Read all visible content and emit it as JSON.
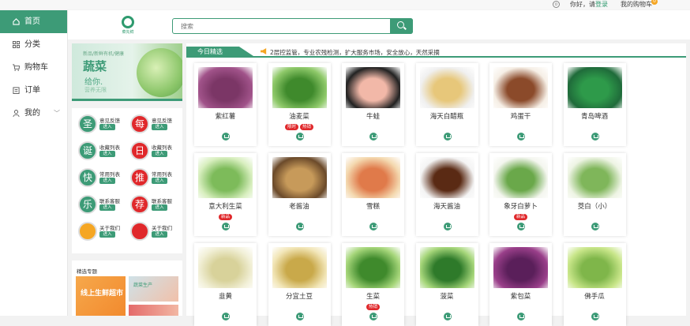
{
  "topbar": {
    "hello": "你好，请",
    "login": "登录",
    "cart_link": "我的购物车",
    "cart_count": "0"
  },
  "sidebar": {
    "items": [
      {
        "label": "首页",
        "icon": "home-icon"
      },
      {
        "label": "分类",
        "icon": "grid-icon"
      },
      {
        "label": "购物车",
        "icon": "cart-icon"
      },
      {
        "label": "订单",
        "icon": "clipboard-icon"
      },
      {
        "label": "我的",
        "icon": "user-icon"
      }
    ]
  },
  "header": {
    "logo_text": "菜先鲜",
    "search_placeholder": "搜索"
  },
  "banner": {
    "sub": "新品/新鲜有机/健康",
    "title": "蔬菜",
    "line2": "给你.",
    "line3": "营养无限"
  },
  "grid": {
    "items": [
      {
        "char": "圣",
        "label": "意见反馈",
        "btn": "进入",
        "color": "#3d9b77"
      },
      {
        "char": "每",
        "label": "意见反馈",
        "btn": "进入",
        "color": "#e0282b"
      },
      {
        "char": "诞",
        "label": "收藏列表",
        "btn": "进入",
        "color": "#3d9b77"
      },
      {
        "char": "日",
        "label": "收藏列表",
        "btn": "进入",
        "color": "#e0282b"
      },
      {
        "char": "快",
        "label": "常用列表",
        "btn": "进入",
        "color": "#3d9b77"
      },
      {
        "char": "推",
        "label": "常用列表",
        "btn": "进入",
        "color": "#e0282b"
      },
      {
        "char": "乐",
        "label": "联系客服",
        "btn": "进入",
        "color": "#3d9b77"
      },
      {
        "char": "荐",
        "label": "联系客服",
        "btn": "进入",
        "color": "#e0282b"
      },
      {
        "char": "",
        "label": "关于我们",
        "btn": "进入",
        "color": "#f5a623"
      },
      {
        "char": "",
        "label": "关于我们",
        "btn": "进入",
        "color": "#e0282b"
      }
    ]
  },
  "recommend": {
    "title": "精选专题",
    "img1_text": "线上生鲜超市",
    "img2_text": "蔬菜生产"
  },
  "main": {
    "tab_today": "今日精选",
    "notice": "2层控监管，专业农残检测，扩大服务市场，安全放心，天然采摘",
    "products": [
      {
        "name": "紫红薯",
        "tags": [],
        "colors": [
          "#a1538a",
          "#7b3666"
        ]
      },
      {
        "name": "油麦菜",
        "tags": [
          "限时",
          "热销"
        ],
        "colors": [
          "#8fc96a",
          "#3f8a2c"
        ]
      },
      {
        "name": "牛蛙",
        "tags": [],
        "colors": [
          "#222222",
          "#f2b8a8"
        ]
      },
      {
        "name": "海天白醋瓶",
        "tags": [],
        "colors": [
          "#f0f0f0",
          "#e7c77a"
        ]
      },
      {
        "name": "鸡蛋干",
        "tags": [],
        "colors": [
          "#f6efe6",
          "#8b4a2a"
        ]
      },
      {
        "name": "青岛啤酒",
        "tags": [],
        "colors": [
          "#1f6b3a",
          "#2e9a4a"
        ]
      },
      {
        "name": "意大利生菜",
        "tags": [
          "新品"
        ],
        "colors": [
          "#d9efc0",
          "#7dbb5a"
        ]
      },
      {
        "name": "老酱油",
        "tags": [],
        "colors": [
          "#6b4a2a",
          "#c79a5a"
        ]
      },
      {
        "name": "雪糕",
        "tags": [],
        "colors": [
          "#f4d9b0",
          "#e07a4a"
        ]
      },
      {
        "name": "海天酱油",
        "tags": [],
        "colors": [
          "#f4f4f4",
          "#5a2a14"
        ]
      },
      {
        "name": "象牙白萝卜",
        "tags": [
          "新品"
        ],
        "colors": [
          "#f4f6ef",
          "#6aa84a"
        ]
      },
      {
        "name": "茭白（小）",
        "tags": [],
        "colors": [
          "#eef4e4",
          "#7fb65a"
        ]
      },
      {
        "name": "韭黄",
        "tags": [],
        "colors": [
          "#f2f0d8",
          "#d8d29a"
        ]
      },
      {
        "name": "分宜土豆",
        "tags": [],
        "colors": [
          "#f2e6b8",
          "#c9a94a"
        ]
      },
      {
        "name": "生菜",
        "tags": [
          "热销"
        ],
        "colors": [
          "#a6d67a",
          "#3f8a2c"
        ]
      },
      {
        "name": "菠菜",
        "tags": [],
        "colors": [
          "#a6d67a",
          "#2e7a2a"
        ]
      },
      {
        "name": "紫包菜",
        "tags": [],
        "colors": [
          "#9a3f8a",
          "#5a1f5a"
        ]
      },
      {
        "name": "佛手瓜",
        "tags": [],
        "colors": [
          "#c9e68a",
          "#7fb64a"
        ]
      }
    ]
  }
}
